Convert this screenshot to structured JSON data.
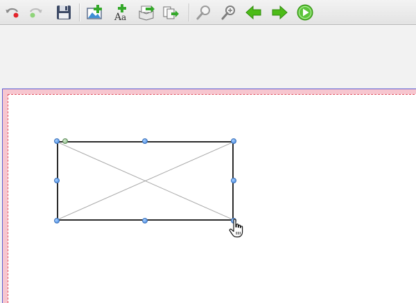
{
  "toolbar": {
    "buttons": [
      {
        "name": "undo-button",
        "icon": "undo-icon"
      },
      {
        "name": "redo-button",
        "icon": "redo-icon"
      },
      {
        "name": "save-button",
        "icon": "floppy-disk-icon"
      },
      {
        "name": "add-image-button",
        "icon": "add-image-icon"
      },
      {
        "name": "add-text-button",
        "icon": "add-text-icon"
      },
      {
        "name": "import-button",
        "icon": "import-icon"
      },
      {
        "name": "export-pages-button",
        "icon": "export-pages-icon"
      },
      {
        "name": "zoom-out-button",
        "icon": "zoom-out-icon"
      },
      {
        "name": "zoom-in-button",
        "icon": "zoom-in-icon"
      },
      {
        "name": "previous-page-button",
        "icon": "arrow-left-icon"
      },
      {
        "name": "next-page-button",
        "icon": "arrow-right-icon"
      },
      {
        "name": "play-button",
        "icon": "play-icon"
      }
    ]
  },
  "colors": {
    "toolbar_bg": "#e8e8e8",
    "page_border_bleed": "#f7c6cf",
    "margin_guide": "#e04a5a",
    "selection_handle": "#3d84e0",
    "rotation_handle": "#7fae7a",
    "green_icons": "#4cbb17"
  }
}
